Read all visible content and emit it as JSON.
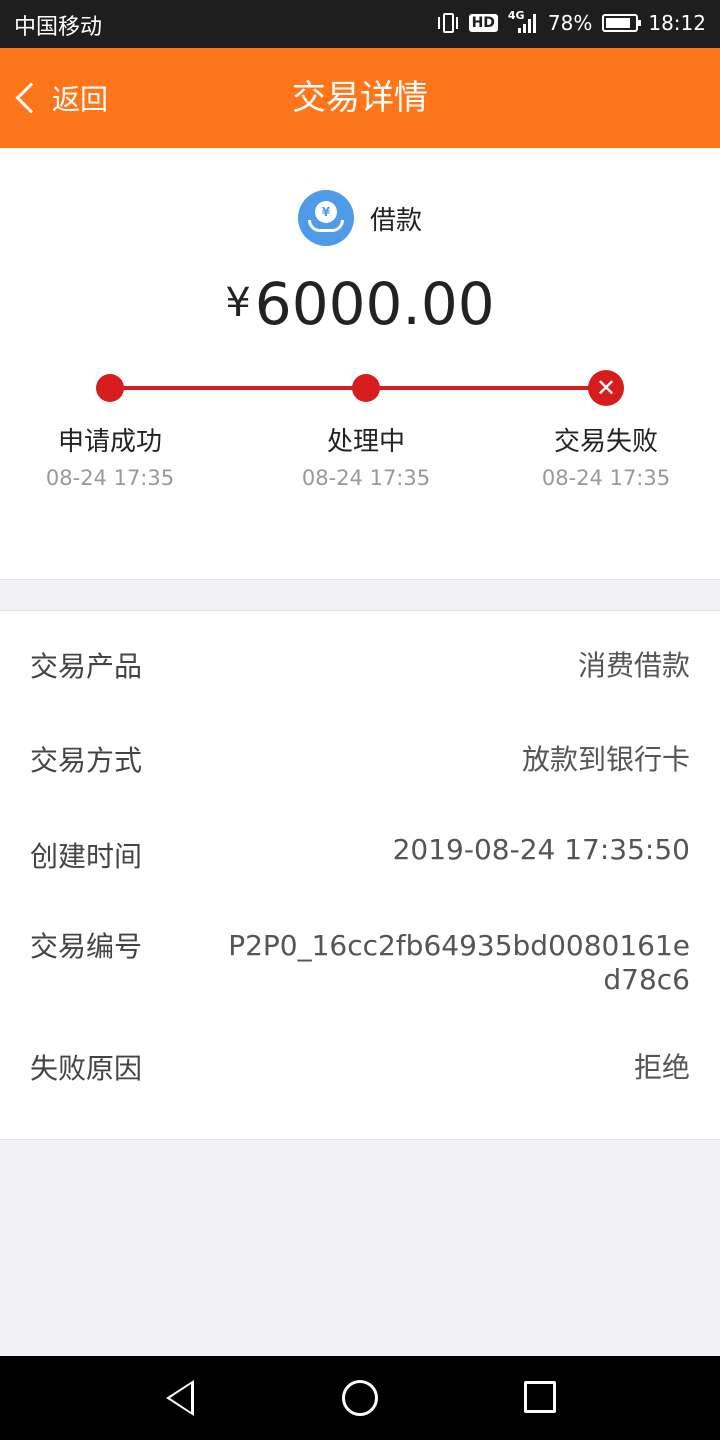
{
  "status_bar": {
    "carrier": "中国移动",
    "hd": "HD",
    "network": "4G",
    "battery": "78%",
    "time": "18:12"
  },
  "header": {
    "back_label": "返回",
    "title": "交易详情",
    "color": "#ff7519"
  },
  "summary": {
    "product": "借款",
    "currency": "¥",
    "amount": "6000.00",
    "steps": [
      {
        "label": "申请成功",
        "time": "08-24 17:35"
      },
      {
        "label": "处理中",
        "time": "08-24 17:35"
      },
      {
        "label": "交易失败",
        "time": "08-24 17:35"
      }
    ],
    "progress_color": "#d61c1c"
  },
  "details": {
    "rows": [
      {
        "label": "交易产品",
        "value": "消费借款"
      },
      {
        "label": "交易方式",
        "value": "放款到银行卡"
      },
      {
        "label": "创建时间",
        "value": "2019-08-24 17:35:50"
      },
      {
        "label": "交易编号",
        "value": "P2P0_16cc2fb64935bd0080161ed78c6"
      },
      {
        "label": "失败原因",
        "value": "拒绝"
      }
    ]
  }
}
